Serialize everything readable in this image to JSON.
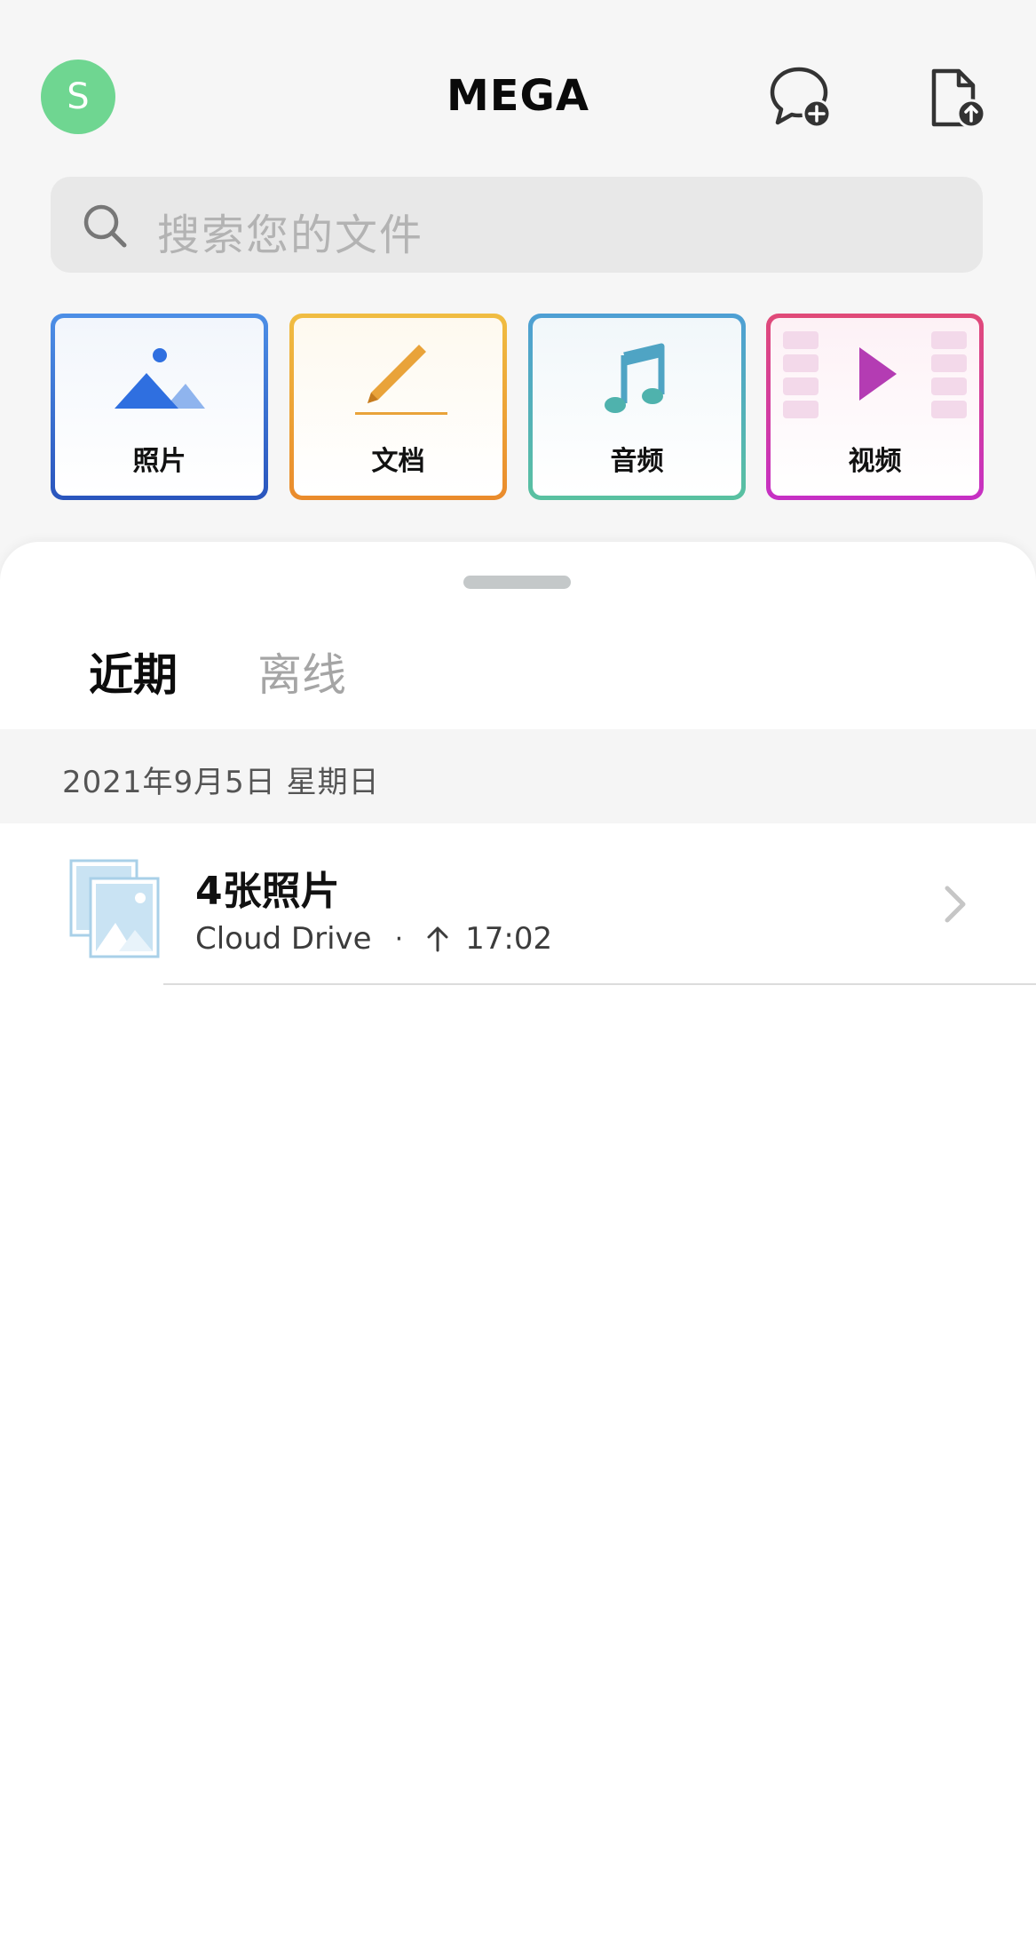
{
  "header": {
    "avatar_initial": "S",
    "title": "MEGA",
    "icons": [
      "new-chat-icon",
      "upload-file-icon"
    ]
  },
  "search": {
    "placeholder": "搜索您的文件"
  },
  "categories": [
    {
      "label": "照片",
      "icon": "photos-icon"
    },
    {
      "label": "文档",
      "icon": "documents-icon"
    },
    {
      "label": "音频",
      "icon": "audio-icon"
    },
    {
      "label": "视频",
      "icon": "video-icon"
    }
  ],
  "tabs": {
    "recent": "近期",
    "offline": "离线"
  },
  "recents": {
    "date_header": "2021年9月5日 星期日",
    "items": [
      {
        "title": "4张照片",
        "location": "Cloud Drive",
        "separator": "·",
        "time": "17:02"
      }
    ]
  },
  "colors": {
    "avatar": "#6fd691",
    "photos": "#2a55bd",
    "documents": "#ea8b2c",
    "audio": "#59c1a0",
    "video": "#c630c5"
  }
}
